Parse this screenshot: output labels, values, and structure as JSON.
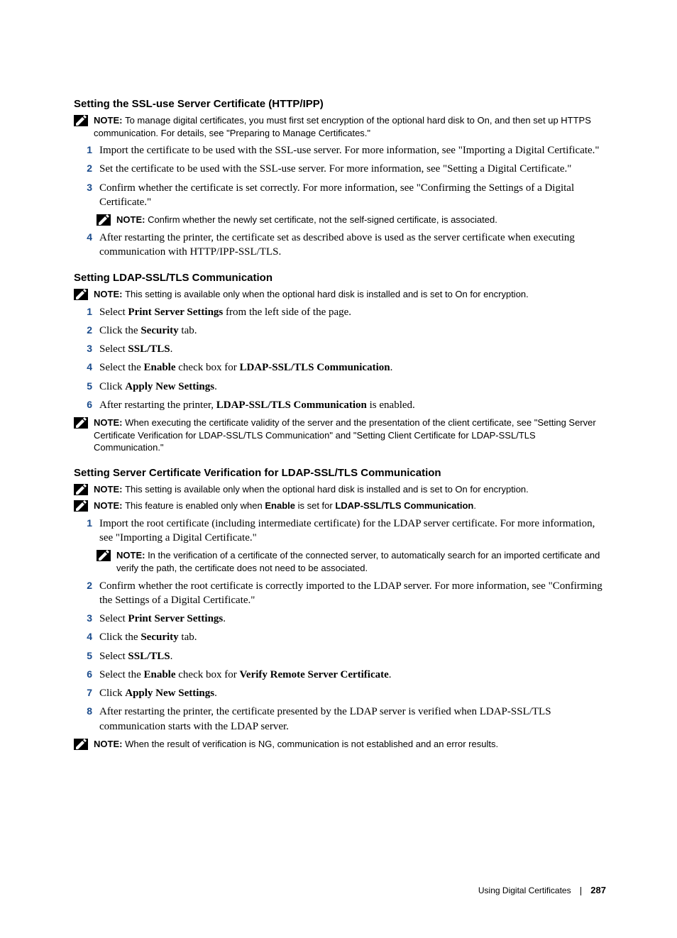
{
  "section1": {
    "heading": "Setting the SSL-use Server Certificate (HTTP/IPP)",
    "note1": "To manage digital certificates, you must first set encryption of the optional hard disk to On, and then set up HTTPS communication. For details, see \"Preparing to Manage Certificates.\"",
    "step1": "Import the certificate to be used with the SSL-use server. For more information, see \"Importing a Digital Certificate.\"",
    "step2": "Set the certificate to be used with the SSL-use server. For more information, see \"Setting a Digital Certificate.\"",
    "step3": "Confirm whether the certificate is set correctly. For more information, see \"Confirming the Settings of a Digital Certificate.\"",
    "note2": "Confirm whether the newly set certificate, not the self-signed certificate, is associated.",
    "step4": "After restarting the printer, the certificate set as described above is used as the server certificate when executing communication with HTTP/IPP-SSL/TLS."
  },
  "section2": {
    "heading": "Setting LDAP-SSL/TLS Communication",
    "note1": "This setting is available only when the optional hard disk is installed and is set to On for encryption.",
    "step1_a": "Select ",
    "step1_b": "Print Server Settings",
    "step1_c": " from the left side of the page.",
    "step2_a": "Click the ",
    "step2_b": "Security",
    "step2_c": " tab.",
    "step3_a": "Select ",
    "step3_b": "SSL/TLS",
    "step3_c": ".",
    "step4_a": "Select the ",
    "step4_b": "Enable",
    "step4_c": " check box for ",
    "step4_d": "LDAP-SSL/TLS Communication",
    "step4_e": ".",
    "step5_a": "Click ",
    "step5_b": "Apply New Settings",
    "step5_c": ".",
    "step6_a": "After restarting the printer, ",
    "step6_b": "LDAP-SSL/TLS Communication",
    "step6_c": " is enabled.",
    "note2": "When executing the certificate validity of the server and the presentation of the client certificate, see \"Setting Server Certificate Verification for LDAP-SSL/TLS Communication\" and \"Setting Client Certificate for LDAP-SSL/TLS Communication.\""
  },
  "section3": {
    "heading": "Setting Server Certificate Verification for LDAP-SSL/TLS Communication",
    "note1": "This setting is available only when the optional hard disk is installed and is set to On for encryption.",
    "note2_a": "This feature is enabled only when ",
    "note2_b": "Enable",
    "note2_c": " is set for ",
    "note2_d": "LDAP-SSL/TLS Communication",
    "note2_e": ".",
    "step1": "Import the root certificate (including intermediate certificate) for the LDAP server certificate. For more information, see \"Importing a Digital Certificate.\"",
    "note3": "In the verification of a certificate of the connected server, to automatically search for an imported certificate and verify the path, the certificate does not need to be associated.",
    "step2": "Confirm whether the root certificate is correctly imported to the LDAP server. For more information, see \"Confirming the Settings of a Digital Certificate.\"",
    "step3_a": "Select ",
    "step3_b": "Print Server Settings",
    "step3_c": ".",
    "step4_a": "Click the ",
    "step4_b": "Security",
    "step4_c": " tab.",
    "step5_a": "Select ",
    "step5_b": "SSL/TLS",
    "step5_c": ".",
    "step6_a": "Select the ",
    "step6_b": "Enable",
    "step6_c": " check box for ",
    "step6_d": "Verify Remote Server Certificate",
    "step6_e": ".",
    "step7_a": "Click ",
    "step7_b": "Apply New Settings",
    "step7_c": ".",
    "step8": "After restarting the printer, the certificate presented by the LDAP server is verified when LDAP-SSL/TLS communication starts with the LDAP server.",
    "note4": "When the result of verification is NG, communication is not established and an error results."
  },
  "labels": {
    "note": "NOTE: ",
    "n1": "1",
    "n2": "2",
    "n3": "3",
    "n4": "4",
    "n5": "5",
    "n6": "6",
    "n7": "7",
    "n8": "8"
  },
  "footer": {
    "title": "Using Digital Certificates",
    "page": "287"
  }
}
